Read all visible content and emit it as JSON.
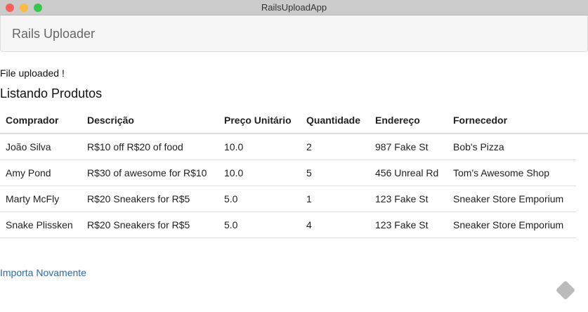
{
  "window": {
    "title": "RailsUploadApp"
  },
  "navbar": {
    "brand": "Rails Uploader"
  },
  "notice": "File uploaded !",
  "heading": "Listando Produtos",
  "table": {
    "headers": [
      "Comprador",
      "Descrição",
      "Preço Unitário",
      "Quantidade",
      "Endereço",
      "Fornecedor"
    ],
    "rows": [
      [
        "João Silva",
        "R$10 off R$20 of food",
        "10.0",
        "2",
        "987 Fake St",
        "Bob's Pizza"
      ],
      [
        "Amy Pond",
        "R$30 of awesome for R$10",
        "10.0",
        "5",
        "456 Unreal Rd",
        "Tom's Awesome Shop"
      ],
      [
        "Marty McFly",
        "R$20 Sneakers for R$5",
        "5.0",
        "1",
        "123 Fake St",
        "Sneaker Store Emporium"
      ],
      [
        "Snake Plissken",
        "R$20 Sneakers for R$5",
        "5.0",
        "4",
        "123 Fake St",
        "Sneaker Store Emporium"
      ]
    ]
  },
  "link": "Importa Novamente",
  "icons": {
    "corner": "feedback-icon"
  }
}
